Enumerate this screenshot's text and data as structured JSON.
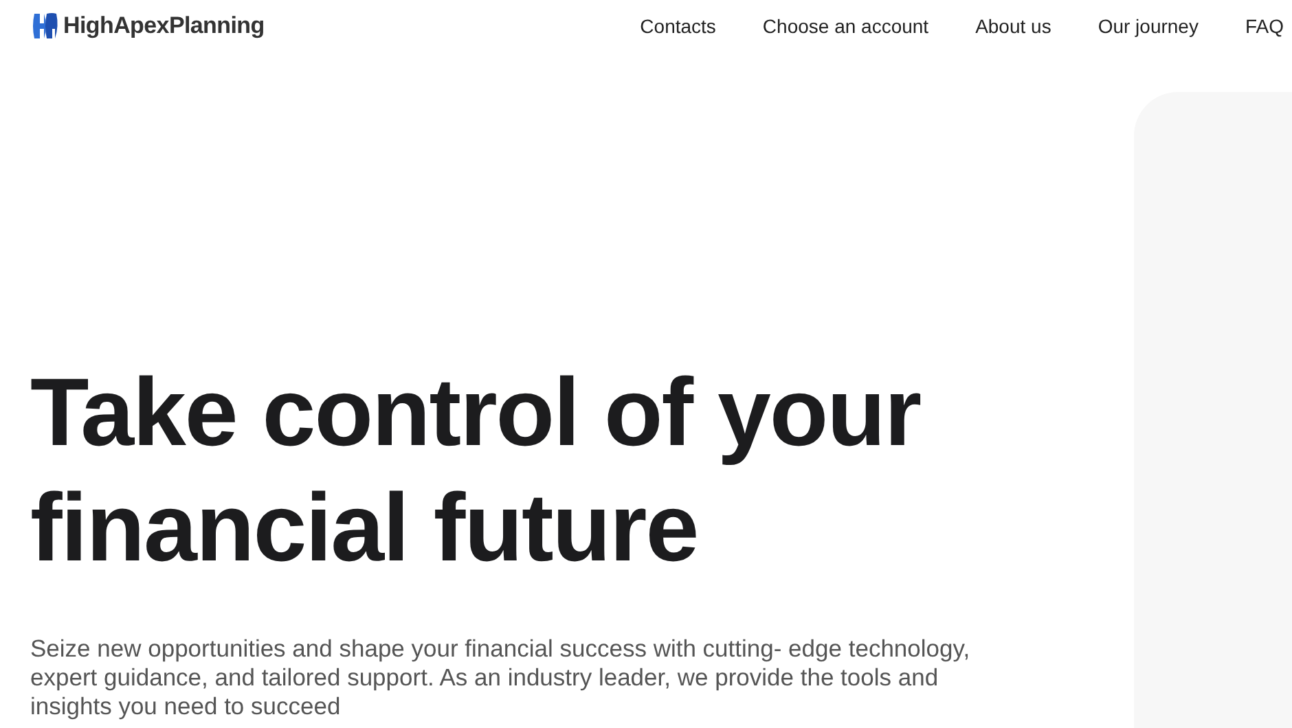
{
  "header": {
    "logo_text": "HighApexPlanning",
    "nav": [
      "Contacts",
      "Choose an account",
      "About us",
      "Our journey",
      "FAQ"
    ]
  },
  "hero": {
    "heading": "Take control of your financial future",
    "description": "Seize new opportunities and shape your financial success with cutting- edge technology, expert guidance, and tailored support. As an industry leader, we provide the tools and insights you need to succeed"
  }
}
